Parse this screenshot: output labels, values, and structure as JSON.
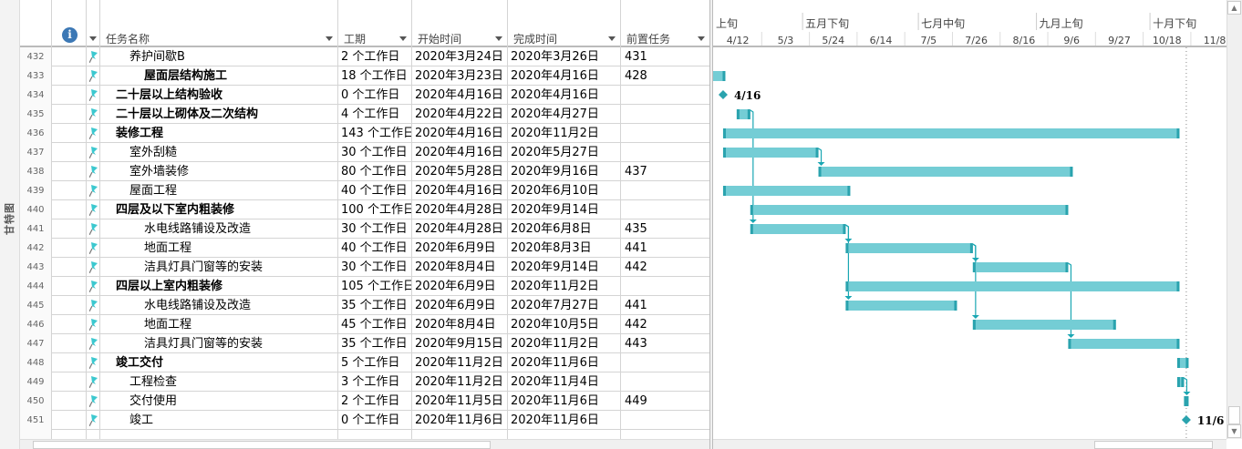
{
  "side_label": "甘特图",
  "table_header": {
    "info_icon": "i",
    "columns": [
      "任务名称",
      "工期",
      "开始时间",
      "完成时间",
      "前置任务"
    ]
  },
  "timescale": {
    "origin": "2020-04-12",
    "upper": [
      {
        "label": "上旬",
        "date": "2020-04-01"
      },
      {
        "label": "五月下旬",
        "date": "2020-05-21"
      },
      {
        "label": "七月中旬",
        "date": "2020-07-11"
      },
      {
        "label": "九月上旬",
        "date": "2020-09-01"
      },
      {
        "label": "十月下旬",
        "date": "2020-10-21"
      }
    ],
    "lower": [
      "4/12",
      "5/3",
      "5/24",
      "6/14",
      "7/5",
      "7/26",
      "8/16",
      "9/6",
      "9/27",
      "10/18",
      "11/8"
    ]
  },
  "colors": {
    "bar": "#74cdd5",
    "bar_cap": "#2aa3ae",
    "link": "#1aa7b3",
    "milestone": "#2aa3ae"
  },
  "status_date": "2020-11-06",
  "tasks": [
    {
      "id": "432",
      "name": "养护间歇B",
      "level": 2,
      "bold": false,
      "duration": "2 个工作日",
      "start": "2020年3月24日",
      "finish": "2020年3月26日",
      "pred": "431",
      "s": "2020-03-24",
      "f": "2020-03-26"
    },
    {
      "id": "433",
      "name": "屋面层结构施工",
      "level": 3,
      "bold": true,
      "duration": "18 个工作日",
      "start": "2020年3月23日",
      "finish": "2020年4月16日",
      "pred": "428",
      "s": "2020-03-23",
      "f": "2020-04-16"
    },
    {
      "id": "434",
      "name": "二十层以上结构验收",
      "level": 1,
      "bold": true,
      "duration": "0 个工作日",
      "start": "2020年4月16日",
      "finish": "2020年4月16日",
      "pred": "",
      "s": "2020-04-16",
      "f": "2020-04-16",
      "milestone": true,
      "mlabel": "4/16"
    },
    {
      "id": "435",
      "name": "二十层以上砌体及二次结构",
      "level": 1,
      "bold": true,
      "duration": "4 个工作日",
      "start": "2020年4月22日",
      "finish": "2020年4月27日",
      "pred": "",
      "s": "2020-04-22",
      "f": "2020-04-27"
    },
    {
      "id": "436",
      "name": "装修工程",
      "level": 1,
      "bold": true,
      "duration": "143 个工作日",
      "start": "2020年4月16日",
      "finish": "2020年11月2日",
      "pred": "",
      "s": "2020-04-16",
      "f": "2020-11-02"
    },
    {
      "id": "437",
      "name": "室外刮糙",
      "level": 2,
      "bold": false,
      "duration": "30 个工作日",
      "start": "2020年4月16日",
      "finish": "2020年5月27日",
      "pred": "",
      "s": "2020-04-16",
      "f": "2020-05-27"
    },
    {
      "id": "438",
      "name": "室外墙装修",
      "level": 2,
      "bold": false,
      "duration": "80 个工作日",
      "start": "2020年5月28日",
      "finish": "2020年9月16日",
      "pred": "437",
      "s": "2020-05-28",
      "f": "2020-09-16"
    },
    {
      "id": "439",
      "name": "屋面工程",
      "level": 2,
      "bold": false,
      "duration": "40 个工作日",
      "start": "2020年4月16日",
      "finish": "2020年6月10日",
      "pred": "",
      "s": "2020-04-16",
      "f": "2020-06-10"
    },
    {
      "id": "440",
      "name": "四层及以下室内粗装修",
      "level": 1,
      "bold": true,
      "duration": "100 个工作日",
      "start": "2020年4月28日",
      "finish": "2020年9月14日",
      "pred": "",
      "s": "2020-04-28",
      "f": "2020-09-14"
    },
    {
      "id": "441",
      "name": "水电线路铺设及改造",
      "level": 3,
      "bold": false,
      "duration": "30 个工作日",
      "start": "2020年4月28日",
      "finish": "2020年6月8日",
      "pred": "435",
      "s": "2020-04-28",
      "f": "2020-06-08"
    },
    {
      "id": "442",
      "name": "地面工程",
      "level": 3,
      "bold": false,
      "duration": "40 个工作日",
      "start": "2020年6月9日",
      "finish": "2020年8月3日",
      "pred": "441",
      "s": "2020-06-09",
      "f": "2020-08-03"
    },
    {
      "id": "443",
      "name": "洁具灯具门窗等的安装",
      "level": 3,
      "bold": false,
      "duration": "30 个工作日",
      "start": "2020年8月4日",
      "finish": "2020年9月14日",
      "pred": "442",
      "s": "2020-08-04",
      "f": "2020-09-14"
    },
    {
      "id": "444",
      "name": "四层以上室内粗装修",
      "level": 1,
      "bold": true,
      "duration": "105 个工作日",
      "start": "2020年6月9日",
      "finish": "2020年11月2日",
      "pred": "",
      "s": "2020-06-09",
      "f": "2020-11-02"
    },
    {
      "id": "445",
      "name": "水电线路铺设及改造",
      "level": 3,
      "bold": false,
      "duration": "35 个工作日",
      "start": "2020年6月9日",
      "finish": "2020年7月27日",
      "pred": "441",
      "s": "2020-06-09",
      "f": "2020-07-27"
    },
    {
      "id": "446",
      "name": "地面工程",
      "level": 3,
      "bold": false,
      "duration": "45 个工作日",
      "start": "2020年8月4日",
      "finish": "2020年10月5日",
      "pred": "442",
      "s": "2020-08-04",
      "f": "2020-10-05"
    },
    {
      "id": "447",
      "name": "洁具灯具门窗等的安装",
      "level": 3,
      "bold": false,
      "duration": "35 个工作日",
      "start": "2020年9月15日",
      "finish": "2020年11月2日",
      "pred": "443",
      "s": "2020-09-15",
      "f": "2020-11-02"
    },
    {
      "id": "448",
      "name": "竣工交付",
      "level": 1,
      "bold": true,
      "duration": "5 个工作日",
      "start": "2020年11月2日",
      "finish": "2020年11月6日",
      "pred": "",
      "s": "2020-11-02",
      "f": "2020-11-06"
    },
    {
      "id": "449",
      "name": "工程检查",
      "level": 2,
      "bold": false,
      "duration": "3 个工作日",
      "start": "2020年11月2日",
      "finish": "2020年11月4日",
      "pred": "",
      "s": "2020-11-02",
      "f": "2020-11-04"
    },
    {
      "id": "450",
      "name": "交付使用",
      "level": 2,
      "bold": false,
      "duration": "2 个工作日",
      "start": "2020年11月5日",
      "finish": "2020年11月6日",
      "pred": "449",
      "s": "2020-11-05",
      "f": "2020-11-06"
    },
    {
      "id": "451",
      "name": "竣工",
      "level": 2,
      "bold": false,
      "duration": "0 个工作日",
      "start": "2020年11月6日",
      "finish": "2020年11月6日",
      "pred": "",
      "s": "2020-11-06",
      "f": "2020-11-06",
      "milestone": true,
      "mlabel": "11/6"
    }
  ]
}
